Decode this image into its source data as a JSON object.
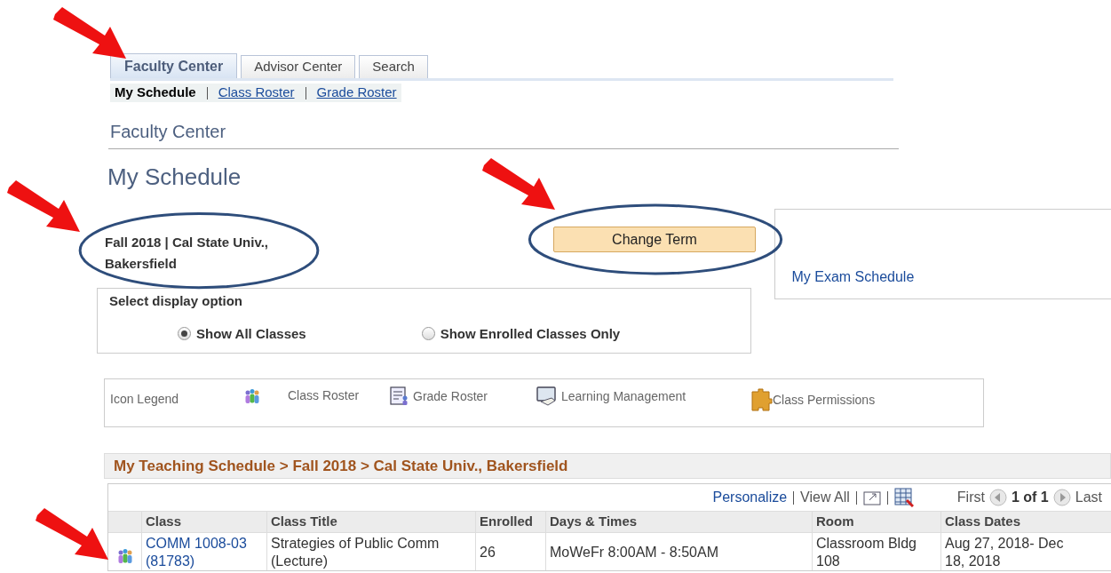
{
  "tabs": [
    {
      "label": "Faculty Center",
      "selected": true
    },
    {
      "label": "Advisor Center",
      "selected": false
    },
    {
      "label": "Search",
      "selected": false
    }
  ],
  "subnav": [
    {
      "label": "My Schedule",
      "selected": true
    },
    {
      "label": "Class Roster",
      "selected": false
    },
    {
      "label": "Grade Roster",
      "selected": false
    }
  ],
  "page_header": "Faculty Center",
  "page_title": "My Schedule",
  "term": "Fall 2018 | Cal State Univ., Bakersfield",
  "change_term_button": "Change Term",
  "exam_schedule_link": "My Exam Schedule",
  "display_options": {
    "title": "Select display option",
    "options": [
      {
        "label": "Show All Classes",
        "selected": true
      },
      {
        "label": "Show Enrolled Classes Only",
        "selected": false
      }
    ]
  },
  "icon_legend": {
    "label": "Icon Legend",
    "items": [
      {
        "kind": "roster",
        "label": "Class Roster"
      },
      {
        "kind": "grade",
        "label": "Grade Roster"
      },
      {
        "kind": "learning",
        "label": "Learning Management"
      },
      {
        "kind": "permissions",
        "label": "Class Permissions"
      }
    ]
  },
  "schedule": {
    "title": "My Teaching Schedule > Fall 2018 > Cal State Univ., Bakersfield",
    "toolbar": {
      "personalize": "Personalize",
      "view_all": "View All",
      "first": "First",
      "page": "1 of 1",
      "last": "Last"
    },
    "columns": [
      "Class",
      "Class Title",
      "Enrolled",
      "Days & Times",
      "Room",
      "Class Dates"
    ],
    "rows": [
      {
        "cells": [
          "COMM 1008-03 (81783)",
          "Strategies of Public Comm (Lecture)",
          "26",
          "MoWeFr 8:00AM - 8:50AM",
          "Classroom Bldg 108",
          "Aug 27, 2018- Dec 18, 2018"
        ]
      }
    ]
  }
}
